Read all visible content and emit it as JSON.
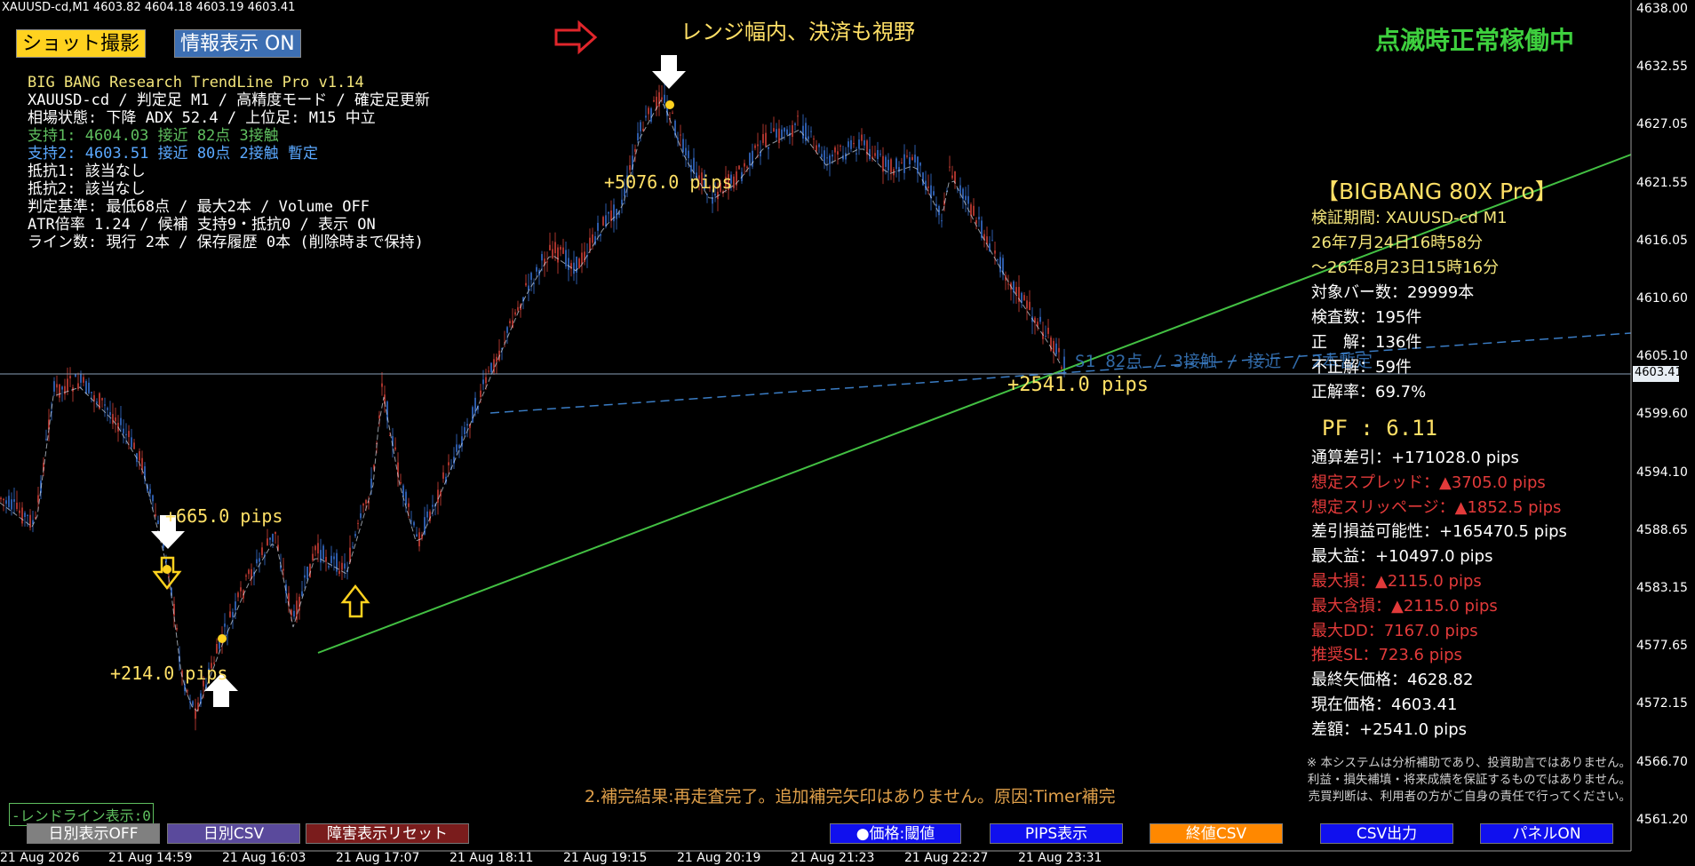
{
  "window": {
    "title": "XAUUSD-cd,M1  4603.82 4604.18 4603.19 4603.41"
  },
  "toolbar_top": {
    "screenshot_btn": "ショット撮影",
    "info_btn": "情報表示 ON"
  },
  "headline": {
    "range_text": "レンジ幅内、決済も視野",
    "status_text": "点滅時正常稼働中"
  },
  "info_panel": {
    "lines": [
      {
        "text": "BIG BANG Research TrendLine Pro v1.14",
        "color": "#f2e47a"
      },
      {
        "text": "XAUUSD-cd / 判定足 M1 / 高精度モード / 確定足更新",
        "color": "#ffffff"
      },
      {
        "text": "相場状態: 下降  ADX 52.4 / 上位足: M15 中立",
        "color": "#ffffff"
      },
      {
        "text": "支持1: 4604.03  接近  82点  3接触",
        "color": "#5fbf5f"
      },
      {
        "text": "支持2: 4603.51  接近  80点  2接触 暫定",
        "color": "#5aa8ff"
      },
      {
        "text": "抵抗1: 該当なし",
        "color": "#ffffff"
      },
      {
        "text": "抵抗2: 該当なし",
        "color": "#ffffff"
      },
      {
        "text": "判定基準: 最低68点 / 最大2本 / Volume OFF",
        "color": "#ffffff"
      },
      {
        "text": "ATR倍率 1.24 / 候補 支持9・抵抗0 / 表示 ON",
        "color": "#ffffff"
      },
      {
        "text": "ライン数: 現行 2本 / 保存履歴 0本 (削除時まで保持)",
        "color": "#ffffff"
      }
    ]
  },
  "chart_labels": {
    "pips_top": "+5076.0 pips",
    "pips_current": "+2541.0 pips",
    "pips_left": "+665.0 pips",
    "pips_low": "+214.0 pips",
    "trendline_label": "S1  82点 / 3接触 / 接近 / 2本暫定",
    "completion_msg": "2.補完結果:再走査完了。追加補完矢印はありません。原因:Timer補完",
    "trendline_toggle": "-レンドライン表示:0"
  },
  "stats_panel": {
    "title": "【BIGBANG 80X Pro】",
    "rows": [
      {
        "text": "検証期間:  XAUUSD-cd M1",
        "color": "#f2e47a"
      },
      {
        "text": "26年7月24日16時58分",
        "color": "#f2e47a"
      },
      {
        "text": "～26年8月23日15時16分",
        "color": "#f2e47a"
      },
      {
        "text": "対象バー数：29999本",
        "color": "#ffffff"
      },
      {
        "text": "検査数：195件",
        "color": "#ffffff"
      },
      {
        "text": "正　解：136件",
        "color": "#ffffff"
      },
      {
        "text": "不正解：59件",
        "color": "#ffffff"
      },
      {
        "text": "正解率：69.7%",
        "color": "#ffffff"
      }
    ],
    "pf": "PF  : 6.11",
    "rows2": [
      {
        "text": "通算差引：+171028.0 pips",
        "color": "#ffffff"
      },
      {
        "text": "想定スプレッド：▲3705.0 pips",
        "color": "#e23a3a"
      },
      {
        "text": "想定スリッページ：▲1852.5 pips",
        "color": "#e23a3a"
      },
      {
        "text": "差引損益可能性：+165470.5 pips",
        "color": "#ffffff"
      },
      {
        "text": "最大益：+10497.0 pips",
        "color": "#ffffff"
      },
      {
        "text": "最大損：▲2115.0 pips",
        "color": "#e23a3a"
      },
      {
        "text": "最大含損：▲2115.0 pips",
        "color": "#e23a3a"
      },
      {
        "text": "最大DD：7167.0 pips",
        "color": "#e23a3a"
      },
      {
        "text": "推奨SL：723.6 pips",
        "color": "#e23a3a"
      },
      {
        "text": "最終矢価格：4628.82",
        "color": "#ffffff"
      },
      {
        "text": "現在価格：4603.41",
        "color": "#ffffff"
      },
      {
        "text": "差額：+2541.0 pips",
        "color": "#ffffff"
      }
    ],
    "disclaimer": [
      "※ 本システムは分析補助であり、投資助言ではありません。",
      "利益・損失補填・将来成績を保証するものではありません。",
      "売買判断は、利用者の方がご自身の責任で行ってください。"
    ]
  },
  "bottom_buttons": {
    "daily_off": "日別表示OFF",
    "daily_csv": "日別CSV",
    "fault_reset": "障害表示リセット",
    "price_threshold": "●価格:閾値",
    "pips_display": "PIPS表示",
    "close_csv": "終値CSV",
    "csv_output": "CSV出力",
    "panel_on": "パネルON"
  },
  "price_axis": {
    "ticks": [
      "4638.00",
      "4632.55",
      "4627.05",
      "4621.55",
      "4616.05",
      "4610.60",
      "4605.10",
      "4599.60",
      "4594.10",
      "4588.65",
      "4583.15",
      "4577.65",
      "4572.15",
      "4566.70",
      "4561.20"
    ],
    "current_price": "4603.41"
  },
  "time_axis": {
    "ticks": [
      "21 Aug 2026",
      "21 Aug 14:59",
      "21 Aug 16:03",
      "21 Aug 17:07",
      "21 Aug 18:11",
      "21 Aug 19:15",
      "21 Aug 20:19",
      "21 Aug 21:23",
      "21 Aug 22:27",
      "21 Aug 23:31"
    ]
  },
  "colors": {
    "bull": "#2c5aa8",
    "bear": "#a8332c",
    "support_line": "#43c043",
    "support2_line": "#3a7cc4",
    "label_yellow": "#ffe066"
  }
}
